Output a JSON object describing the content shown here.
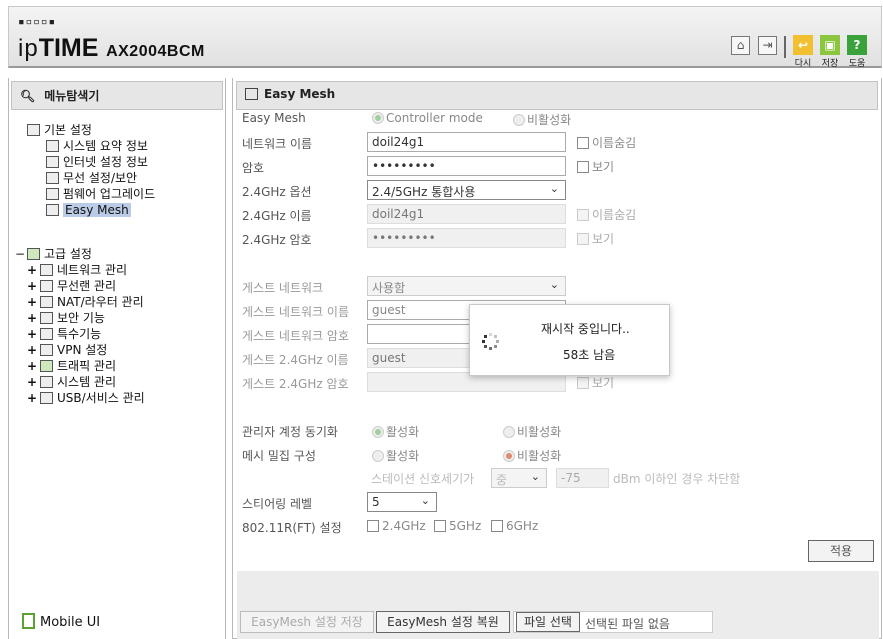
{
  "header": {
    "logo_dots": "▪▫▫▫▪",
    "brand_ip": "ip",
    "brand_time": "TIME",
    "model": "AX2004BCM",
    "buttons": {
      "restart": "다시",
      "save": "저장",
      "help": "도움"
    }
  },
  "sidebar": {
    "title": "메뉴탐색기",
    "basic_group": "기본 설정",
    "basic_items": [
      "시스템 요약 정보",
      "인터넷 설정 정보",
      "무선 설정/보안",
      "펌웨어 업그레이드",
      "Easy Mesh"
    ],
    "adv_toggle": "−",
    "adv_group": "고급 설정",
    "adv_items": [
      "네트워크 관리",
      "무선랜 관리",
      "NAT/라우터 관리",
      "보안 기능",
      "특수기능",
      "VPN 설정",
      "트래픽 관리",
      "시스템 관리",
      "USB/서비스 관리"
    ],
    "expand": "+",
    "mobile": "Mobile UI"
  },
  "main": {
    "title": "Easy Mesh",
    "easy_mesh_label": "Easy Mesh",
    "controller_mode": "Controller mode",
    "disable": "비활성화",
    "enable": "활성화",
    "network_name_label": "네트워크 이름",
    "network_name": "doil24g1",
    "hide_name": "이름숨김",
    "password_label": "암호",
    "password": "•••••••••",
    "show": "보기",
    "band_option_label": "2.4GHz 옵션",
    "band_option": "2.4/5GHz 통합사용",
    "band_name_label": "2.4GHz 이름",
    "band_name": "doil24g1",
    "band_password_label": "2.4GHz 암호",
    "band_password": "•••••••••",
    "guest_network_label": "게스트 네트워크",
    "guest_network": "사용함",
    "guest_name_label": "게스트 네트워크 이름",
    "guest_name": "guest",
    "guest_password_label": "게스트 네트워크 암호",
    "guest_24_name_label": "게스트 2.4GHz 이름",
    "guest_24_name": "guest",
    "guest_24_password_label": "게스트 2.4GHz 암호",
    "admin_sync_label": "관리자 계정 동기화",
    "mesh_density_label": "메시 밀집 구성",
    "station_signal_text": "스테이션 신호세기가",
    "station_signal_level": "중",
    "station_signal_value": "-75",
    "station_signal_suffix": "dBm 이하인 경우 차단함",
    "steering_level_label": "스티어링 레벨",
    "steering_level": "5",
    "ft_label": "802.11R(FT) 설정",
    "ft_options": [
      "2.4GHz",
      "5GHz",
      "6GHz"
    ],
    "apply": "적용",
    "save_settings": "EasyMesh 설정 저장",
    "restore_settings": "EasyMesh 설정 복원",
    "choose_file": "파일 선택",
    "no_file": "선택된 파일 없음"
  },
  "modal": {
    "message": "재시작 중입니다..",
    "remaining": "58초 남음"
  }
}
